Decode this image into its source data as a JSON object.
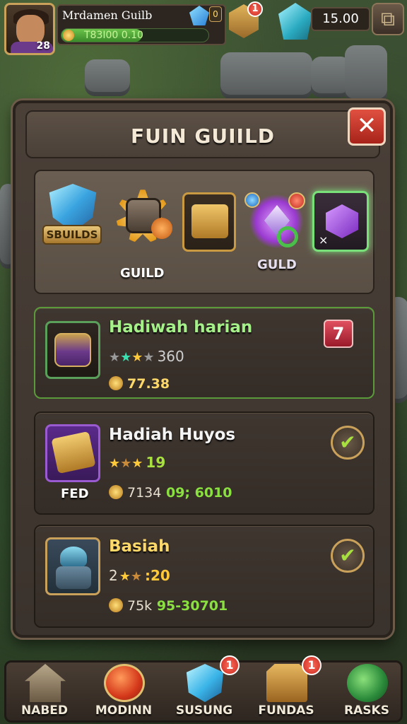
{
  "hud": {
    "player_name": "Mrdamen Guilb",
    "level": "28",
    "xp_text": "T83I00 0.10",
    "xp_progress": 0.55,
    "small_badge": "0",
    "gold_notif": "1",
    "gem_count": "15.00",
    "puzzle_icon": "puzzle-icon"
  },
  "panel": {
    "title": "FUIN GUIILD",
    "close_label": "✕"
  },
  "tabs": [
    {
      "label": "SBUILDS",
      "icon": "shield-gem-icon"
    },
    {
      "label": "GUILD",
      "icon": "chest-burst-icon"
    },
    {
      "label": "",
      "icon": "gold-box-icon"
    },
    {
      "label": "GULD",
      "icon": "magic-ring-icon"
    },
    {
      "label": "",
      "icon": "purple-cube-icon",
      "mark": "×"
    }
  ],
  "rewards": [
    {
      "title": "Hadiwah harian",
      "title_color": "#a6f08a",
      "stars_text": "360",
      "coins_text": "77.38",
      "action": "claim",
      "action_label": "7",
      "icon": "purple-chest-icon"
    },
    {
      "title": "Hadiah Huyos",
      "title_color": "#f4f4f4",
      "stars_text": "19",
      "coins_prefix": "7134",
      "coins_text": "09; 6010",
      "sub_label": "FED",
      "action": "done",
      "action_label": "✔",
      "icon": "gold-block-icon"
    },
    {
      "title": "Basiah",
      "title_color": "#ffd86a",
      "stars_prefix": "2",
      "stars_text": ":20",
      "coins_prefix": "75k",
      "coins_text": "95-30701",
      "action": "done",
      "action_label": "✔",
      "icon": "robot-icon"
    }
  ],
  "bottom_nav": [
    {
      "label": "NABED",
      "icon": "house-icon",
      "badge": ""
    },
    {
      "label": "MODINN",
      "icon": "fruit-icon",
      "badge": ""
    },
    {
      "label": "SUSUNG",
      "icon": "crystal-icon",
      "badge": "1"
    },
    {
      "label": "FUNDAS",
      "icon": "crate-icon",
      "badge": "1"
    },
    {
      "label": "RASKS",
      "icon": "orb-icon",
      "badge": ""
    }
  ]
}
